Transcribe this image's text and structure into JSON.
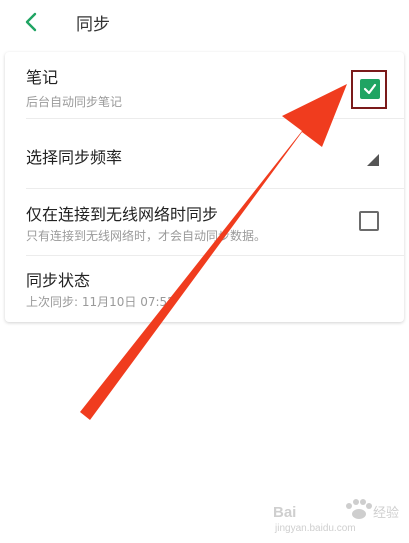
{
  "header": {
    "title": "同步"
  },
  "settings": {
    "notes": {
      "label": "笔记",
      "sub": "后台自动同步笔记",
      "checked": true
    },
    "frequency": {
      "label": "选择同步频率"
    },
    "wifi_only": {
      "label": "仅在连接到无线网络时同步",
      "sub": "只有连接到无线网络时，才会自动同步数据。",
      "checked": false
    },
    "status": {
      "label": "同步状态",
      "sub": "上次同步: 11月10日 07:52"
    }
  },
  "colors": {
    "accent_green": "#1fa463",
    "annotation_red": "#f03c1e",
    "highlight_border": "#7b1a1a"
  },
  "watermark": {
    "brand": "Baidu经验",
    "url": "jingyan.baidu.com"
  }
}
